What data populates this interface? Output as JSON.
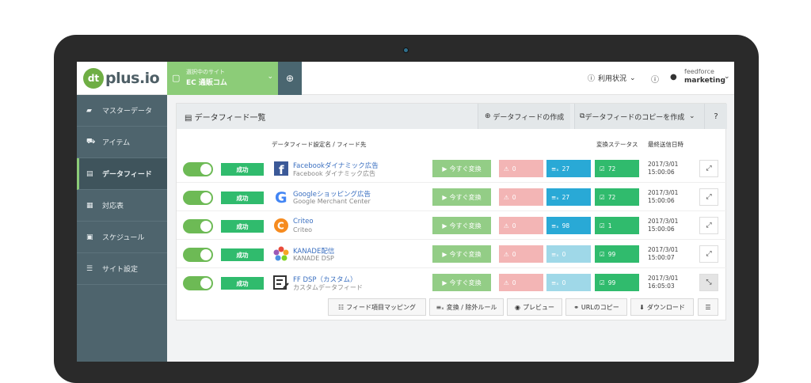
{
  "app": {
    "logo_badge": "dt",
    "logo_text": "plus.io"
  },
  "site": {
    "caption": "選択中のサイト",
    "name": "EC 通販コム",
    "add_icon": "⊕"
  },
  "top": {
    "usage_label": "利用状況",
    "help": "?",
    "company": "feedforce",
    "user": "marketing"
  },
  "sidebar": {
    "items": [
      {
        "label": "マスターデータ",
        "icon": "folder-icon"
      },
      {
        "label": "アイテム",
        "icon": "cart-icon"
      },
      {
        "label": "データフィード",
        "icon": "file-icon",
        "active": true
      },
      {
        "label": "対応表",
        "icon": "table-icon"
      },
      {
        "label": "スケジュール",
        "icon": "calendar-icon"
      },
      {
        "label": "サイト設定",
        "icon": "sliders-icon"
      }
    ]
  },
  "panel": {
    "title": "データフィード一覧",
    "create_label": "データフィードの作成",
    "copy_label": "データフィードのコピーを作成",
    "help": "?"
  },
  "columns": {
    "feed": "データフィード設定名 / フィード先",
    "status": "変換ステータス",
    "last_sent": "最終送信日時"
  },
  "rows": [
    {
      "name": "Facebookダイナミック広告",
      "dest": "Facebook ダイナミック広告",
      "status": "成功",
      "convert": "今すぐ変換",
      "errors": "0",
      "transform": "27",
      "ok": "72",
      "date": "2017/3/01",
      "time": "15:00:06",
      "error_color": "#f3b5b5",
      "transform_color": "#29a9d6",
      "logo": "facebook"
    },
    {
      "name": "Googleショッピング広告",
      "dest": "Google Merchant Center",
      "status": "成功",
      "convert": "今すぐ変換",
      "errors": "0",
      "transform": "27",
      "ok": "72",
      "date": "2017/3/01",
      "time": "15:00:06",
      "error_color": "#f3b5b5",
      "transform_color": "#29a9d6",
      "logo": "google"
    },
    {
      "name": "Criteo",
      "dest": "Criteo",
      "status": "成功",
      "convert": "今すぐ変換",
      "errors": "0",
      "transform": "98",
      "ok": "1",
      "date": "2017/3/01",
      "time": "15:00:06",
      "error_color": "#f3b5b5",
      "transform_color": "#29a9d6",
      "logo": "criteo"
    },
    {
      "name": "KANADE配信",
      "dest": "KANADE DSP",
      "status": "成功",
      "convert": "今すぐ変換",
      "errors": "0",
      "transform": "0",
      "ok": "99",
      "date": "2017/3/01",
      "time": "15:00:07",
      "error_color": "#f3b5b5",
      "transform_color": "#9fd8e8",
      "logo": "kanade"
    },
    {
      "name": "FF DSP（カスタム）",
      "dest": "カスタムデータフィード",
      "status": "成功",
      "convert": "今すぐ変換",
      "errors": "0",
      "transform": "0",
      "ok": "99",
      "date": "2017/3/01",
      "time": "16:05:03",
      "error_color": "#f3b5b5",
      "transform_color": "#9fd8e8",
      "logo": "custom"
    }
  ],
  "actions": {
    "mapping": "フィード項目マッピング",
    "rules": "変換 / 除外ルール",
    "preview": "プレビュー",
    "copy_url": "URLのコピー",
    "download": "ダウンロード"
  },
  "colors": {
    "accent_green": "#8ccc78",
    "success": "#30bb6d",
    "sidebar": "#4e646d"
  }
}
